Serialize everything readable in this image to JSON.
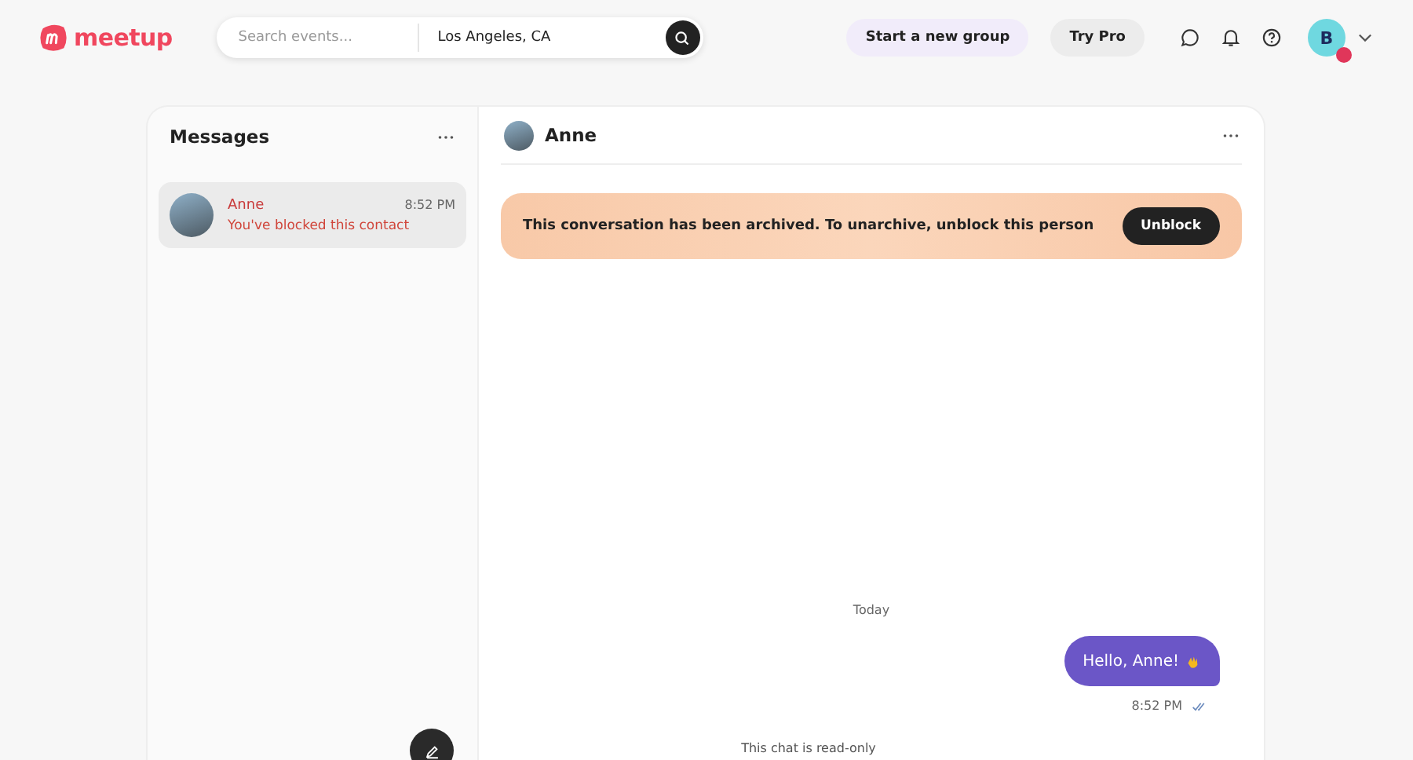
{
  "header": {
    "logo": "meetup",
    "search": {
      "placeholder": "Search events...",
      "location": "Los Angeles, CA"
    },
    "buttons": [
      {
        "label": "Start a new group",
        "kind": "primary"
      },
      {
        "label": "Try Pro",
        "kind": "secondary"
      }
    ],
    "user_initial": "B"
  },
  "messages": {
    "title": "Messages",
    "conversations": [
      {
        "name": "Anne",
        "time": "8:52 PM",
        "preview": "You've blocked this contact",
        "selected": true
      }
    ]
  },
  "chat": {
    "name": "Anne",
    "banner": {
      "text": "This conversation has been archived. To unarchive, unblock this person",
      "button": "Unblock"
    },
    "day": "Today",
    "messages": [
      {
        "text": "Hello, Anne!",
        "time": "8:52 PM",
        "read": true
      }
    ],
    "footer": "This chat is read-only"
  }
}
